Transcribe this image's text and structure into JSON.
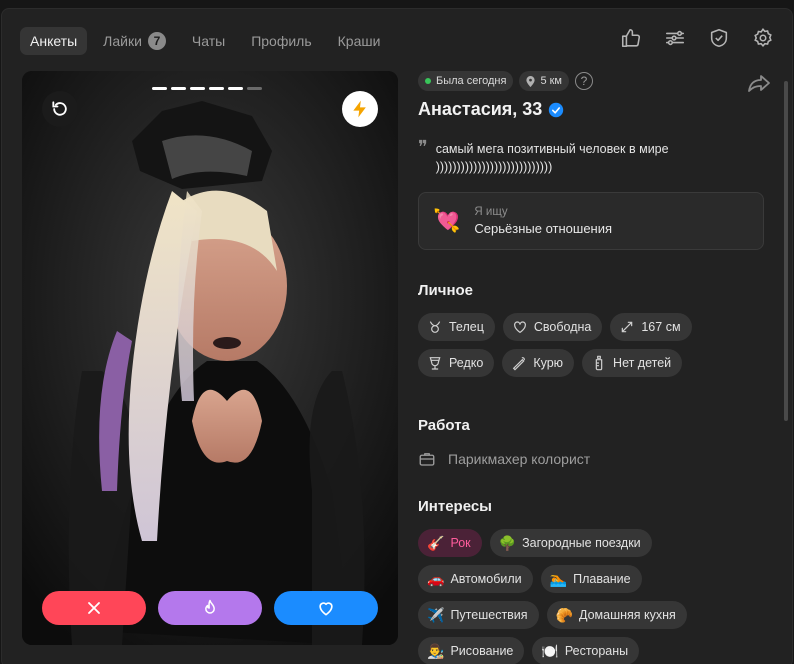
{
  "nav": {
    "tabs": [
      {
        "label": "Анкеты",
        "badge": ""
      },
      {
        "label": "Лайки",
        "badge": "7"
      },
      {
        "label": "Чаты",
        "badge": ""
      },
      {
        "label": "Профиль",
        "badge": ""
      },
      {
        "label": "Краши",
        "badge": ""
      }
    ],
    "icons": [
      "thumbs-up-icon",
      "sliders-icon",
      "shield-check-icon",
      "gear-icon"
    ]
  },
  "photo": {
    "progress_total": 6,
    "progress_active": 5
  },
  "profile": {
    "last_seen": "Была сегодня",
    "distance": "5 км",
    "help": "?",
    "name": "Анастасия, 33",
    "bio": "самый мега позитивный человек в мире ))))))))))))))))))))))))))))",
    "seeking_label": "Я ищу",
    "seeking_value": "Серьёзные отношения",
    "seeking_emoji": "💘"
  },
  "sections": {
    "personal_title": "Личное",
    "work_title": "Работа",
    "interests_title": "Интересы"
  },
  "personal": [
    {
      "icon": "taurus-icon",
      "label": "Телец"
    },
    {
      "icon": "heart-outline-icon",
      "label": "Свободна"
    },
    {
      "icon": "height-icon",
      "label": "167 см"
    },
    {
      "icon": "wine-glass-icon",
      "label": "Редко"
    },
    {
      "icon": "smoking-icon",
      "label": "Курю"
    },
    {
      "icon": "baby-bottle-icon",
      "label": "Нет детей"
    }
  ],
  "work": {
    "icon": "briefcase-icon",
    "label": "Парикмахер колорист"
  },
  "interests": [
    {
      "emoji": "🎸",
      "label": "Рок",
      "highlight": true
    },
    {
      "emoji": "🌳",
      "label": "Загородные поездки",
      "highlight": false
    },
    {
      "emoji": "🚗",
      "label": "Автомобили",
      "highlight": false
    },
    {
      "emoji": "🏊",
      "label": "Плавание",
      "highlight": false
    },
    {
      "emoji": "✈️",
      "label": "Путешествия",
      "highlight": false
    },
    {
      "emoji": "🥐",
      "label": "Домашняя кухня",
      "highlight": false
    },
    {
      "emoji": "👨‍🎨",
      "label": "Рисование",
      "highlight": false
    },
    {
      "emoji": "🍽️",
      "label": "Рестораны",
      "highlight": false
    }
  ],
  "colors": {
    "nope": "#ff4658",
    "superlike": "#b478ec",
    "like": "#1b8cff",
    "rock_tag": "#ff5c9c",
    "verified": "#1b8cff",
    "online": "#39c55a"
  }
}
